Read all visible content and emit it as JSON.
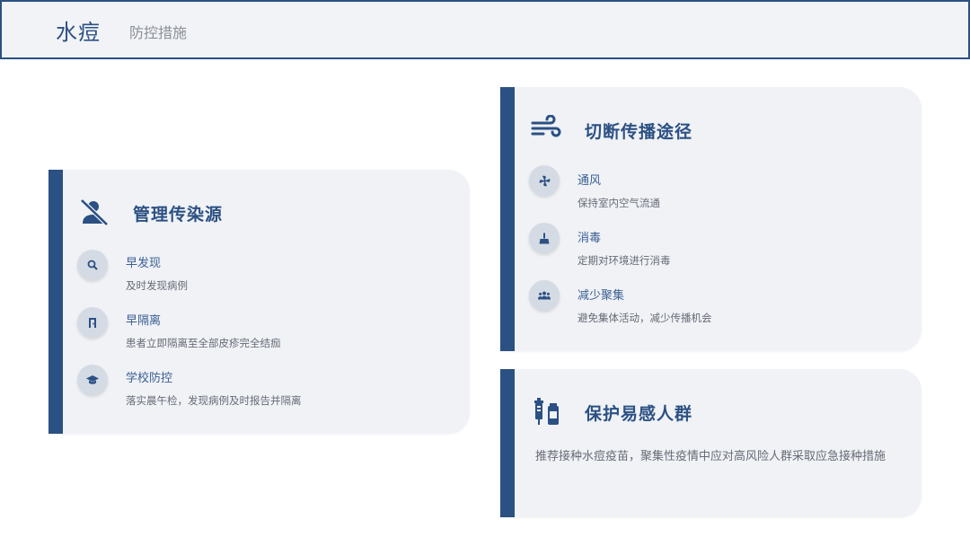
{
  "header": {
    "title": "水痘",
    "subtitle": "防控措施"
  },
  "colors": {
    "accent": "#2b5083",
    "card_bg": "#f0f2f6",
    "circle_bg": "#d5dbe4"
  },
  "source_card": {
    "title": "管理传染源",
    "icon": "person-slash-icon",
    "items": [
      {
        "icon": "search-icon",
        "title": "早发现",
        "desc": "及时发现病例"
      },
      {
        "icon": "door-icon",
        "title": "早隔离",
        "desc": "患者立即隔离至全部皮疹完全结痂"
      },
      {
        "icon": "graduation-cap-icon",
        "title": "学校防控",
        "desc": "落实晨午检，发现病例及时报告并隔离"
      }
    ]
  },
  "route_card": {
    "title": "切断传播途径",
    "icon": "wind-icon",
    "items": [
      {
        "icon": "fan-icon",
        "title": "通风",
        "desc": "保持室内空气流通"
      },
      {
        "icon": "broom-icon",
        "title": "消毒",
        "desc": "定期对环境进行消毒"
      },
      {
        "icon": "people-group-icon",
        "title": "减少聚集",
        "desc": "避免集体活动，减少传播机会"
      }
    ]
  },
  "protect_card": {
    "title": "保护易感人群",
    "icon": "vaccine-icon",
    "text": "推荐接种水痘疫苗，聚集性疫情中应对高风险人群采取应急接种措施"
  }
}
